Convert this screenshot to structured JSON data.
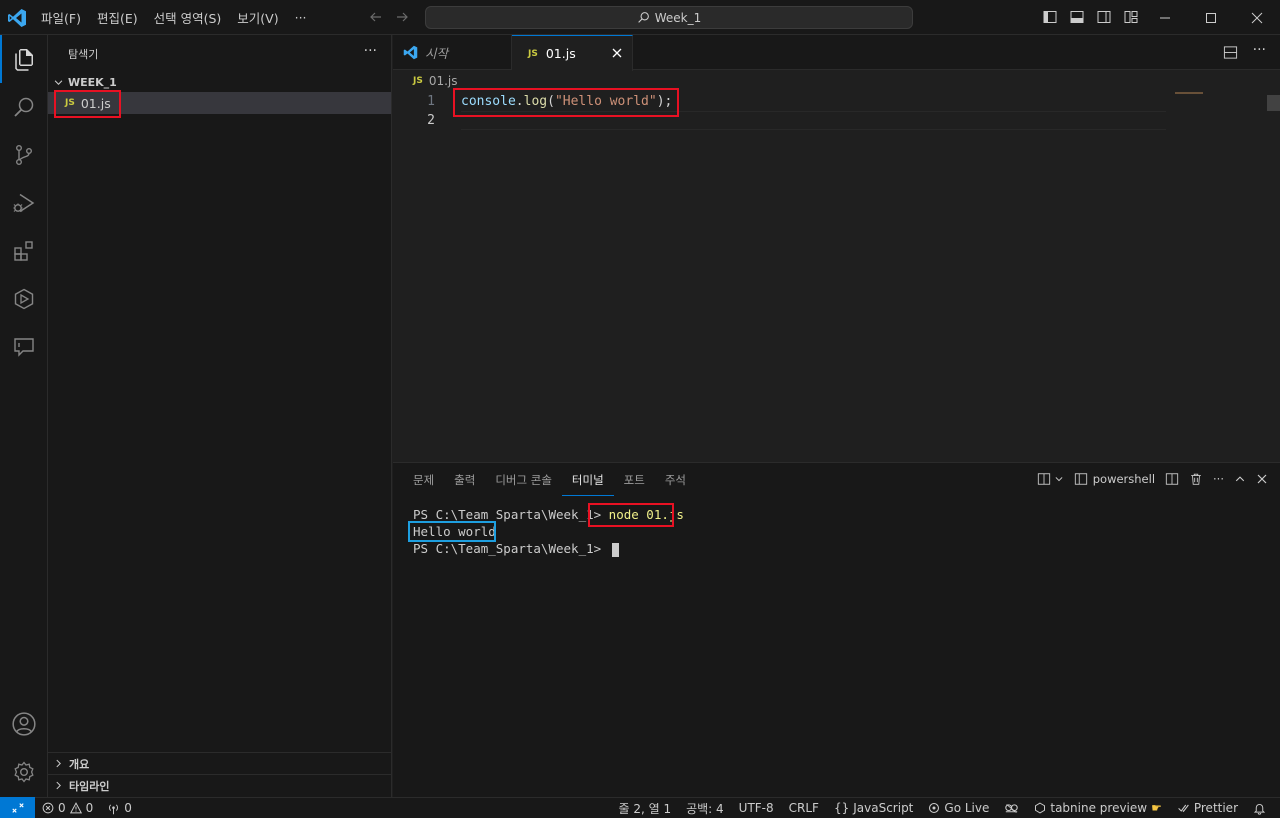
{
  "titlebar": {
    "menu": [
      "파일(F)",
      "편집(E)",
      "선택 영역(S)",
      "보기(V)",
      "···"
    ],
    "search_text": "Week_1"
  },
  "activity": [
    "explorer-icon",
    "search-icon",
    "source-control-icon",
    "run-debug-icon",
    "extensions-icon",
    "remote-explorer-icon",
    "chat-icon",
    "account-icon",
    "settings-gear-icon"
  ],
  "sidebar": {
    "title": "탐색기",
    "more": "···",
    "folder": "WEEK_1",
    "files": [
      {
        "badge": "JS",
        "name": "01.js"
      }
    ],
    "sections": [
      "개요",
      "타임라인"
    ]
  },
  "editor": {
    "tabs": [
      {
        "label": "시작",
        "active": false
      },
      {
        "label": "01.js",
        "badge": "JS",
        "active": true
      }
    ],
    "breadcrumb": {
      "badge": "JS",
      "file": "01.js"
    },
    "lines": [
      {
        "n": "1",
        "tokens": {
          "a": "console",
          "b": ".",
          "c": "log",
          "d": "(",
          "e": "\"Hello world\"",
          "f": ");"
        }
      },
      {
        "n": "2"
      }
    ]
  },
  "panel": {
    "tabs": [
      "문제",
      "출력",
      "디버그 콘솔",
      "터미널",
      "포트",
      "주석"
    ],
    "active_tab": "터미널",
    "shell": "powershell",
    "terminal": {
      "prompt1": "PS C:\\Team_Sparta\\Week_1> ",
      "cmd1": "node 01.js",
      "output": "Hello world",
      "prompt2": "PS C:\\Team_Sparta\\Week_1> "
    }
  },
  "status": {
    "errors": "0",
    "warnings": "0",
    "ports": "0",
    "position": "줄 2, 열 1",
    "spaces": "공백: 4",
    "encoding": "UTF-8",
    "eol": "CRLF",
    "language": "JavaScript",
    "golive": "Go Live",
    "tabnine": "tabnine preview",
    "prettier": "Prettier"
  },
  "colors": {
    "accent": "#0078d4",
    "highlight_red": "#e81123",
    "highlight_blue": "#1e9fe0",
    "js_yellow": "#cbcb41"
  }
}
